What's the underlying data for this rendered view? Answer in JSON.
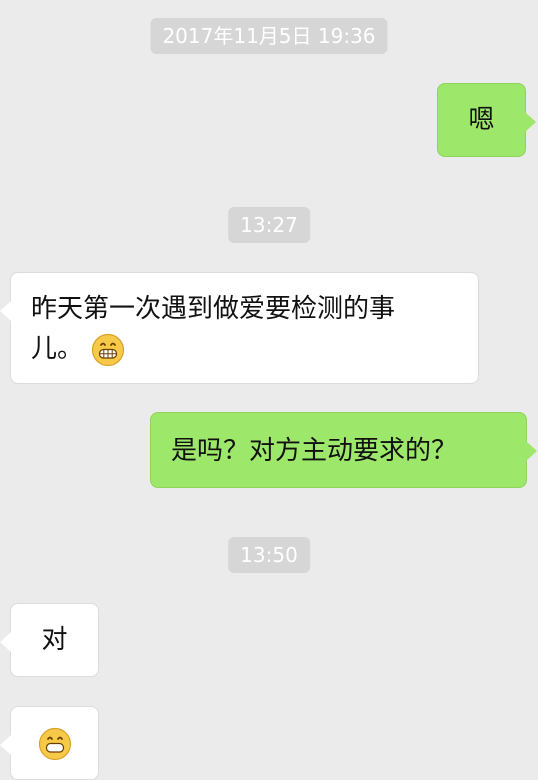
{
  "chat": {
    "timestamps": {
      "t1": "2017年11月5日 19:36",
      "t2": "13:27",
      "t3": "13:50"
    },
    "messages": {
      "m1": {
        "text": "嗯"
      },
      "m2": {
        "line1": "昨天第一次遇到做爱要检测的事",
        "line2": "儿。",
        "emoji": "grinning-emoji"
      },
      "m3": {
        "text": "是吗？对方主动要求的？"
      },
      "m4": {
        "text": "对"
      },
      "m5": {
        "emoji": "grinning-emoji"
      }
    },
    "colors": {
      "background": "#ebebeb",
      "sent_bubble": "#9de86a",
      "received_bubble": "#ffffff",
      "timestamp_bg": "#d6d6d6"
    }
  }
}
